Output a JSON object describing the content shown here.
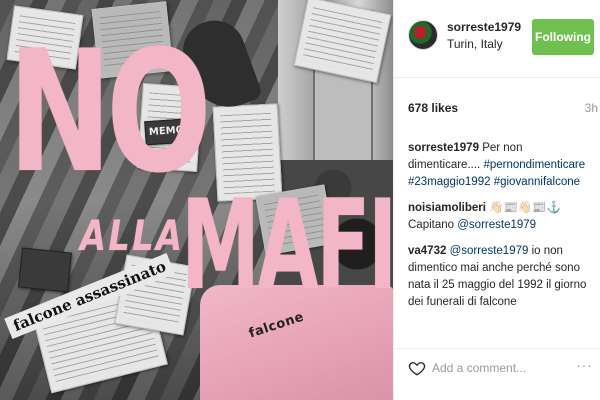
{
  "photo": {
    "headline_top": "NO",
    "headline_middle": "ALLA",
    "headline_bottom": "MAFIA",
    "shirt_text": "falcone",
    "newspaper_text": "falcone assassinato",
    "memo_text": "MEMO"
  },
  "post": {
    "username": "sorreste1979",
    "location": "Turin, Italy",
    "follow_label": "Following",
    "likes": "678 likes",
    "time": "3h"
  },
  "comments": [
    {
      "user": "sorreste1979",
      "text": "Per non dimenticare....",
      "tags": [
        "#pernondimenticare",
        "#23maggio1992",
        "#giovannifalcone"
      ]
    },
    {
      "user": "noisiamoliberi",
      "text": "👋🏻📰👋🏻📰⚓ Capitano",
      "mention": "@sorreste1979"
    },
    {
      "user": "va4732",
      "mention": "@sorreste1979",
      "text": "io non dimentico mai anche perché sono nata il 25 maggio del 1992 il giorno dei funerali di falcone"
    }
  ],
  "footer": {
    "placeholder": "Add a comment...",
    "more_label": "···"
  },
  "colors": {
    "follow_green": "#70c050",
    "hashtag_blue": "#003569",
    "headline_pink": "#f2b6c6"
  },
  "icons": {
    "heart": "heart-icon",
    "more": "more-options-icon"
  }
}
